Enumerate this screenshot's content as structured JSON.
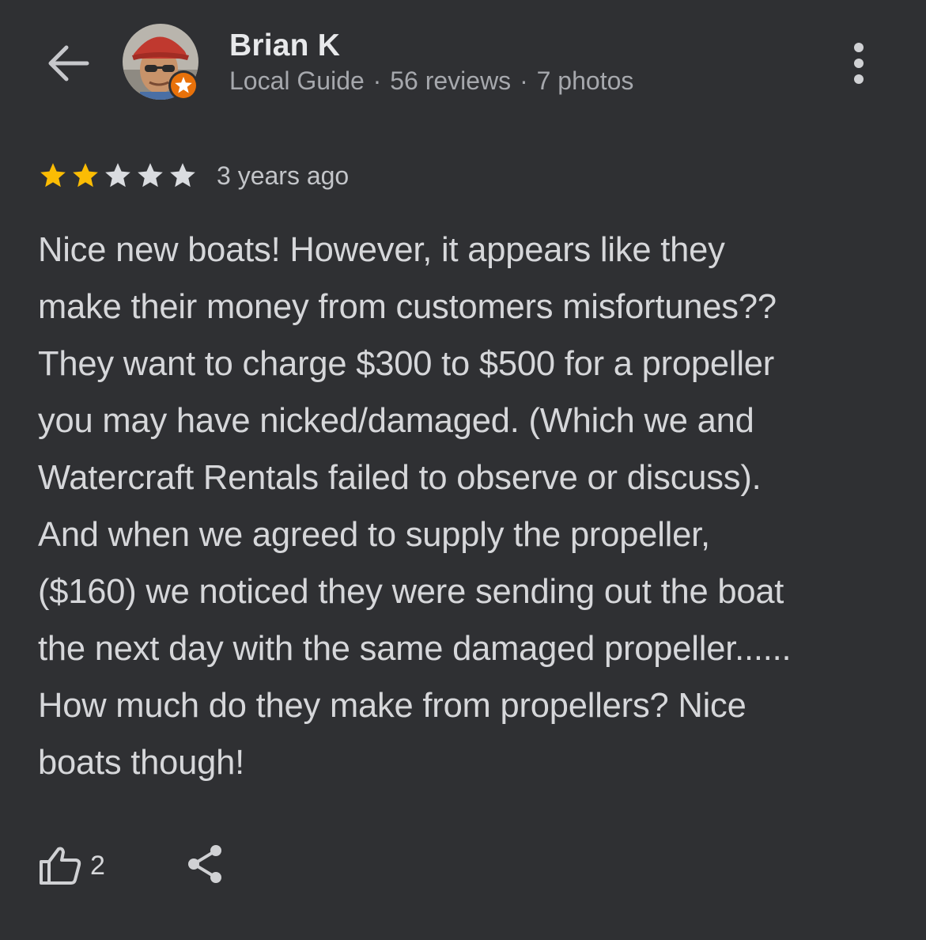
{
  "header": {
    "back_icon": "arrow-left-icon",
    "author": {
      "name": "Brian K",
      "role": "Local Guide",
      "separator": "·",
      "reviews": "56 reviews",
      "photos": "7 photos",
      "badge_icon": "local-guide-star-badge-icon",
      "badge_color": "#e8710a"
    },
    "menu_icon": "more-vertical-icon"
  },
  "review": {
    "rating": 2,
    "max_rating": 5,
    "star_filled_color": "#fbbc04",
    "star_empty_color": "#dadce0",
    "date": "3 years ago",
    "lines": [
      "Nice new boats! However, it appears like they",
      "make their money from customers misfortunes??",
      "They want to charge $300 to $500 for a propeller",
      "you may have nicked/damaged. (Which we and",
      "Watercraft Rentals failed to observe or discuss).",
      "And when we agreed to supply the propeller,",
      "($160) we noticed they were sending out the boat",
      "the next day with the same damaged propeller......",
      "How much do they make from propellers? Nice",
      "boats though!"
    ]
  },
  "actions": {
    "like_icon": "thumbs-up-icon",
    "like_count": "2",
    "share_icon": "share-icon"
  },
  "colors": {
    "background": "#2f3033",
    "text": "#d6d7da",
    "secondary_text": "#a6a8ad"
  }
}
